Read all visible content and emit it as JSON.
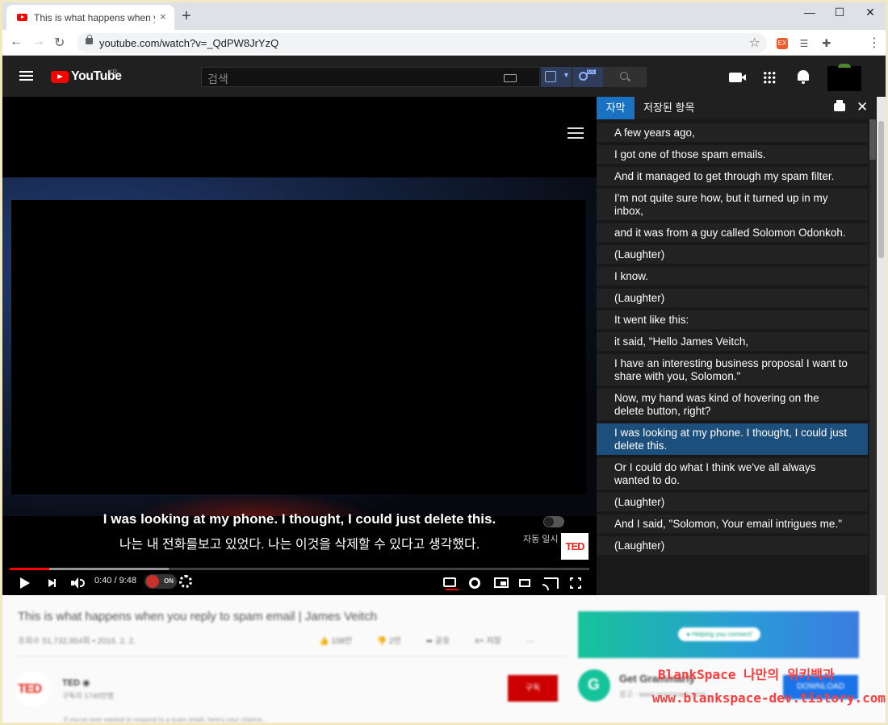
{
  "browser": {
    "tab_title": "This is what happens when you reply to spam email | James Veitch",
    "tab_close": "×",
    "new_tab": "+",
    "url": "youtube.com/watch?v=_QdPW8JrYzQ",
    "star": "☆",
    "window_controls": {
      "minimize": "—",
      "maximize": "☐",
      "close": "✕"
    },
    "extensions": [
      "gx-icon",
      "list-icon",
      "puzzle-icon"
    ],
    "menu": "⋮"
  },
  "youtube": {
    "logo_text": "YouTube",
    "region": "KR",
    "search_placeholder": "검색"
  },
  "player": {
    "caption_en": "I was looking at my phone. I thought, I could just delete this.",
    "caption_ko": "나는 내 전화를보고 있었다. 나는 이것을 삭제할 수 있다고 생각했다.",
    "autopause_label": "자동 일시 중지",
    "watermark": "TED",
    "time": "0:40 / 9:48",
    "ext_toggle": "ON",
    "progress_played": 0.068,
    "progress_buffered": 0.275
  },
  "transcript": {
    "tab_active": "자막",
    "tab_saved": "저장된 항목",
    "lines": [
      "A few years ago,",
      "I got one of those spam emails.",
      "And it managed to get through my spam filter.",
      "I'm not quite sure how, but it turned up in my inbox,",
      "and it was from a guy called Solomon Odonkoh.",
      "(Laughter)",
      "I know.",
      "(Laughter)",
      "It went like this:",
      "it said, \"Hello James Veitch,",
      "I have an interesting business proposal I want to share with you, Solomon.\"",
      "Now, my hand was kind of hovering on the delete button, right?",
      "I was looking at my phone. I thought, I could just delete this.",
      "Or I could do what I think we've all always wanted to do.",
      "(Laughter)",
      "And I said, \"Solomon, Your email intrigues me.\"",
      "(Laughter)"
    ],
    "active_index": 12
  },
  "below": {
    "video_title": "This is what happens when you reply to spam email | James Veitch",
    "meta": "조회수 51,732,954회 • 2016. 2. 2.",
    "like": "👍 108만",
    "dislike": "👎 2만",
    "share": "➦ 공유",
    "save": "≡+ 저장",
    "more": "···",
    "channel_logo": "TED",
    "channel_name": "TED ◉",
    "channel_subs": "구독자 1740만명",
    "subscribe": "구독",
    "ad_pill": "● Helping you connect!",
    "ad_logo": "G",
    "ad_title": "Get Grammarly",
    "ad_label": "광고 · www.grammarly.com",
    "ad_button": "DOWNLOAD",
    "description_cut": "If you've ever wanted to respond to a scam email, here's your chance..."
  },
  "watermark": {
    "line1": "BlankSpace 나만의 위키백과",
    "line2": "www.blankspace-dev.tistory.com"
  }
}
